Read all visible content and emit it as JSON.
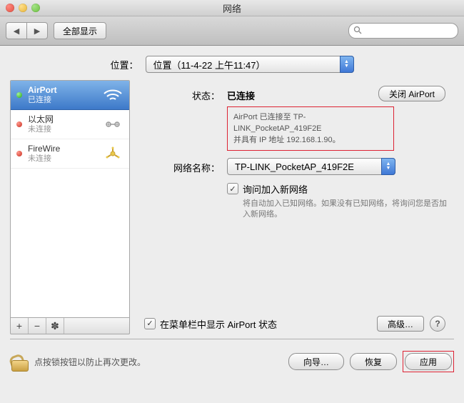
{
  "window": {
    "title": "网络"
  },
  "toolbar": {
    "show_all_label": "全部显示",
    "search_placeholder": ""
  },
  "location": {
    "label": "位置：",
    "value": "位置（11-4-22 上午11:47）"
  },
  "sidebar": {
    "items": [
      {
        "title": "AirPort",
        "subtitle": "已连接",
        "status_color": "green",
        "icon": "wifi-icon",
        "selected": true
      },
      {
        "title": "以太网",
        "subtitle": "未连接",
        "status_color": "red",
        "icon": "ethernet-icon",
        "selected": false
      },
      {
        "title": "FireWire",
        "subtitle": "未连接",
        "status_color": "red",
        "icon": "firewire-icon",
        "selected": false
      }
    ],
    "footer": {
      "add": "+",
      "remove": "−",
      "action": "✽"
    }
  },
  "detail": {
    "status_label": "状态：",
    "status_value": "已连接",
    "turn_off_label": "关闭 AirPort",
    "status_desc_line1": "AirPort 已连接至 TP-LINK_PocketAP_419F2E",
    "status_desc_line2": "并具有 IP 地址 192.168.1.90。",
    "network_name_label": "网络名称：",
    "network_name_value": "TP-LINK_PocketAP_419F2E",
    "ask_join_label": "询问加入新网络",
    "ask_join_hint": "将自动加入已知网络。如果没有已知网络，将询问您是否加入新网络。",
    "show_status_label": "在菜单栏中显示 AirPort 状态",
    "advanced_label": "高级…"
  },
  "footer": {
    "lock_text": "点按锁按钮以防止再次更改。",
    "guide_label": "向导…",
    "revert_label": "恢复",
    "apply_label": "应用"
  }
}
